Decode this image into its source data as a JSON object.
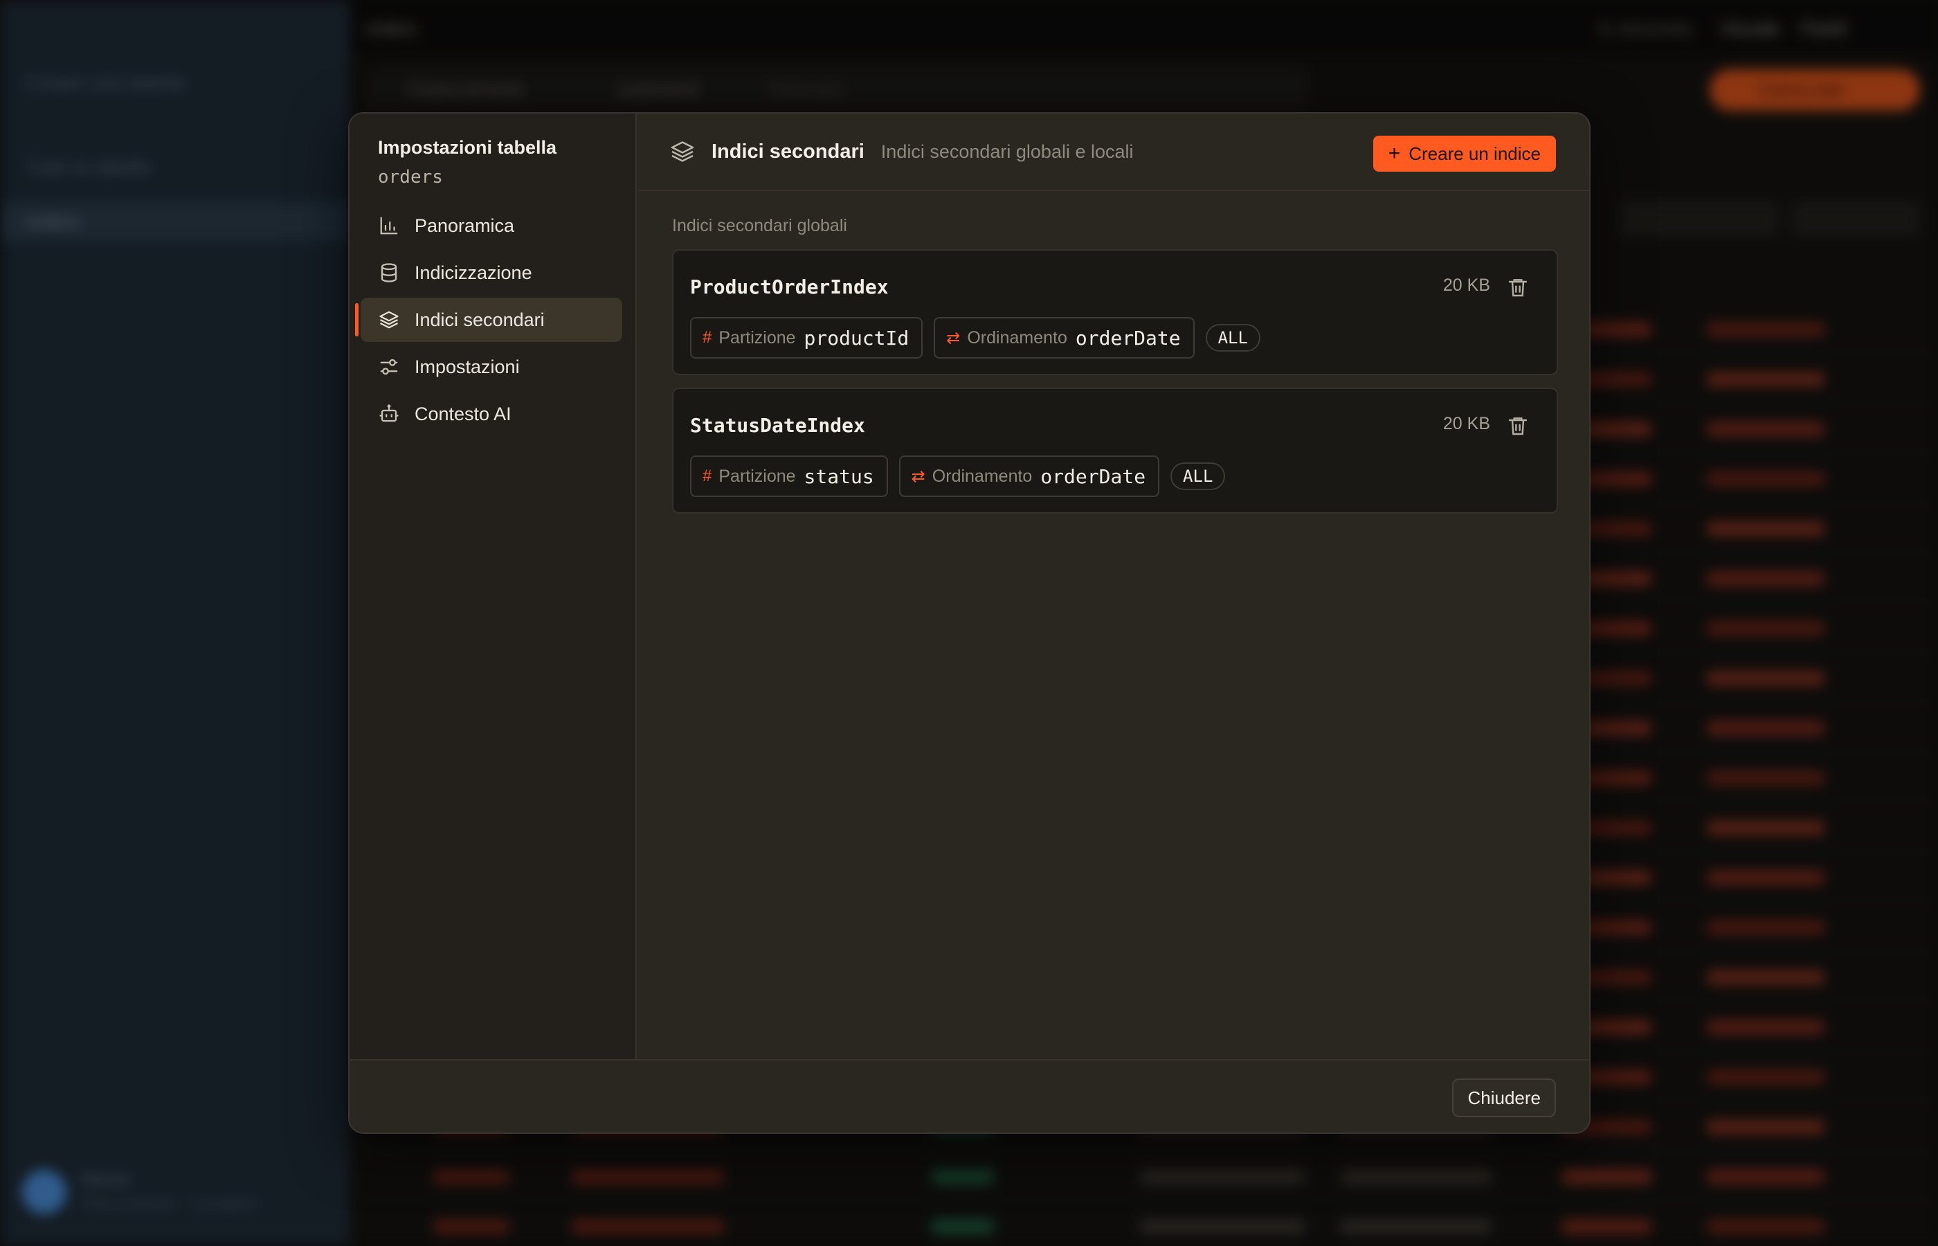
{
  "background": {
    "sidebar": {
      "top_action": "Creare una tabella",
      "items": [
        "Tutte le tabelle",
        "orders"
      ]
    },
    "topbar": {
      "table_name": "orders",
      "status": "In sincronia",
      "tabs": [
        "Visuale",
        "Partiti"
      ]
    },
    "filter": {
      "key_selector": "Chiave primaria",
      "field": "customerId",
      "placeholder": "Cerca per..."
    },
    "primary_button": "Carica dati",
    "toolbar": [
      "Aggiornare",
      "Nuovo item"
    ],
    "user": {
      "name": "Demo",
      "subtitle": "Piano gratuito · 1 progetto"
    }
  },
  "dialog": {
    "title": "Impostazioni tabella",
    "table": "orders",
    "nav": [
      {
        "label": "Panoramica",
        "icon": "bar-chart-icon",
        "active": false
      },
      {
        "label": "Indicizzazione",
        "icon": "database-icon",
        "active": false
      },
      {
        "label": "Indici secondari",
        "icon": "layers-icon",
        "active": true
      },
      {
        "label": "Impostazioni",
        "icon": "sliders-icon",
        "active": false
      },
      {
        "label": "Contesto AI",
        "icon": "bot-icon",
        "active": false
      }
    ],
    "header": {
      "icon": "layers-icon",
      "title": "Indici secondari",
      "description": "Indici secondari globali e locali",
      "create_button": "Creare un indice"
    },
    "section_label": "Indici secondari globali",
    "indexes": [
      {
        "name": "ProductOrderIndex",
        "size": "20 KB",
        "partition_label": "Partizione",
        "partition_key": "productId",
        "sort_label": "Ordinamento",
        "sort_key": "orderDate",
        "projection": "ALL"
      },
      {
        "name": "StatusDateIndex",
        "size": "20 KB",
        "partition_label": "Partizione",
        "partition_key": "status",
        "sort_label": "Ordinamento",
        "sort_key": "orderDate",
        "projection": "ALL"
      }
    ],
    "footer": {
      "close_button": "Chiudere"
    }
  },
  "colors": {
    "accent": "#ff5a1f",
    "dialog_bg": "#2a2620",
    "card_bg": "#1a1814",
    "sidebar_bg": "#1f2c38"
  }
}
